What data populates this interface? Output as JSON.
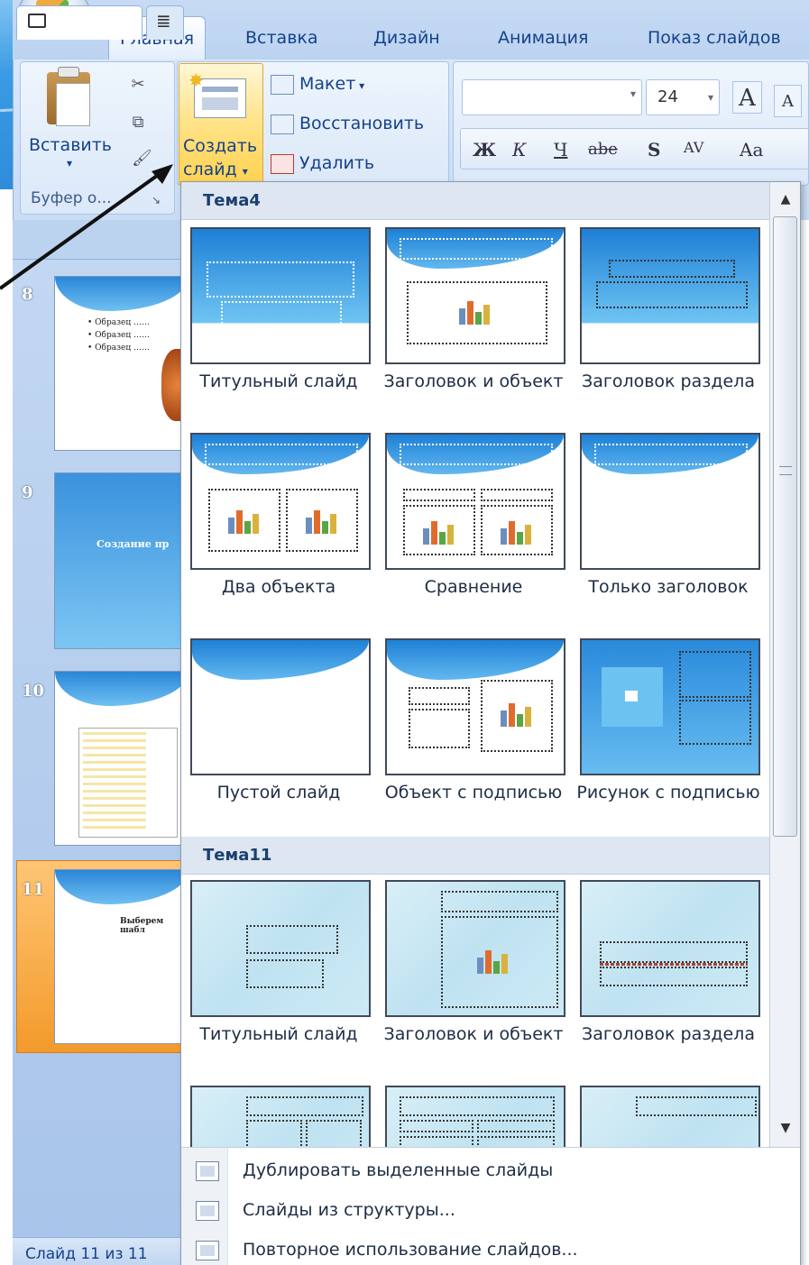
{
  "ribbon": {
    "tabs": [
      {
        "label": "Главная",
        "active": true
      },
      {
        "label": "Вставка"
      },
      {
        "label": "Дизайн"
      },
      {
        "label": "Анимация"
      },
      {
        "label": "Показ слайдов"
      }
    ],
    "clipboard": {
      "paste_label": "Вставить",
      "group_label": "Буфер о..."
    },
    "slides": {
      "create_label_line1": "Создать",
      "create_label_line2": "слайд",
      "layout_label": "Макет",
      "reset_label": "Восстановить",
      "delete_label": "Удалить"
    },
    "font": {
      "size_value": "24",
      "bold": "Ж",
      "italic": "К",
      "underline": "Ч",
      "strike": "abe",
      "shadow": "S",
      "spacing": "AV",
      "case": "Aa",
      "grow": "A",
      "shrink": "A"
    }
  },
  "slide_panel": {
    "slides": [
      {
        "number": "8",
        "bullets": [
          "• Образец ……",
          "• Образец ……",
          "• Образец ……"
        ]
      },
      {
        "number": "9",
        "title": "Создание пр"
      },
      {
        "number": "10"
      },
      {
        "number": "11",
        "text": "Выберем шабл",
        "selected": true
      }
    ],
    "status": "Слайд 11 из 11"
  },
  "dropdown": {
    "themes": [
      {
        "name": "Тема4",
        "layouts": [
          {
            "label": "Титульный слайд"
          },
          {
            "label": "Заголовок и объект"
          },
          {
            "label": "Заголовок раздела"
          },
          {
            "label": "Два объекта"
          },
          {
            "label": "Сравнение"
          },
          {
            "label": "Только заголовок"
          },
          {
            "label": "Пустой слайд"
          },
          {
            "label": "Объект с подписью"
          },
          {
            "label": "Рисунок с подписью"
          }
        ]
      },
      {
        "name": "Тема11",
        "layouts": [
          {
            "label": "Титульный слайд"
          },
          {
            "label": "Заголовок и объект"
          },
          {
            "label": "Заголовок раздела"
          }
        ]
      }
    ],
    "menu": [
      {
        "label": "Дублировать выделенные слайды"
      },
      {
        "label": "Слайды из структуры..."
      },
      {
        "label": "Повторное использование слайдов..."
      }
    ]
  },
  "colors": {
    "ribbon_text": "#15428b",
    "theme4_blue": "#1e80d6",
    "theme11_aqua": "#bfe2f1",
    "selected_slide": "#f39a2b"
  }
}
